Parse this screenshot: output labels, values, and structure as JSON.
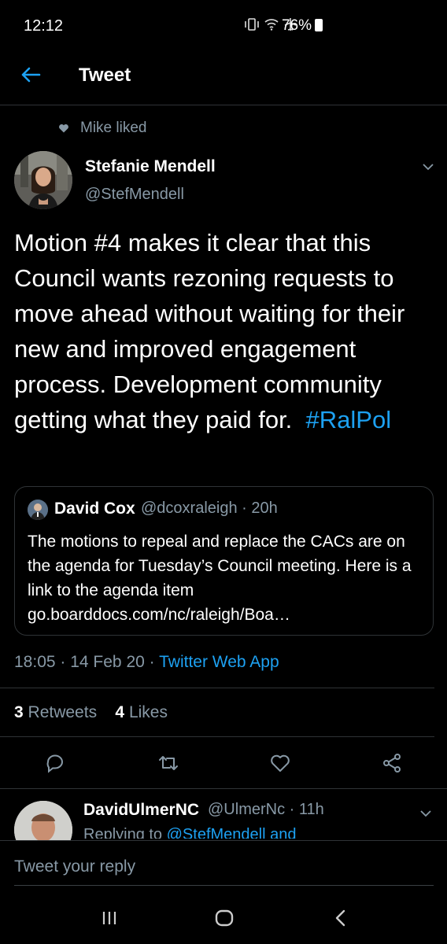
{
  "status_bar": {
    "time": "12:12",
    "battery": "76%"
  },
  "header": {
    "title": "Tweet"
  },
  "social_context": {
    "text": "Mike liked"
  },
  "tweet": {
    "author_name": "Stefanie Mendell",
    "author_handle": "@StefMendell",
    "text": "Motion #4 makes it clear that this Council wants rezoning requests to move ahead without waiting for their new and improved engagement process. Development community getting what they paid for.",
    "hashtag": "#RalPol",
    "time": "18:05",
    "date": "14 Feb 20",
    "source": "Twitter Web App",
    "retweets_count": "3",
    "retweets_label": "Retweets",
    "likes_count": "4",
    "likes_label": "Likes"
  },
  "quoted_tweet": {
    "author_name": "David Cox",
    "author_handle": "@dcoxraleigh",
    "age": "20h",
    "text": "The motions to repeal and replace the CACs are on the agenda for Tuesday’s Council meeting.  Here is a link to the agenda item go.boarddocs.com/nc/raleigh/Boa…"
  },
  "reply": {
    "author_name": "DavidUlmerNC",
    "author_handle": "@UlmerNc",
    "age": "11h",
    "partial_prefix": "Replying to",
    "partial_link": "@StefMendell and"
  },
  "composer": {
    "placeholder": "Tweet your reply"
  },
  "colors": {
    "accent": "#1da1f2",
    "muted": "#8899a6",
    "divider": "#2f3336",
    "background": "#000000"
  }
}
